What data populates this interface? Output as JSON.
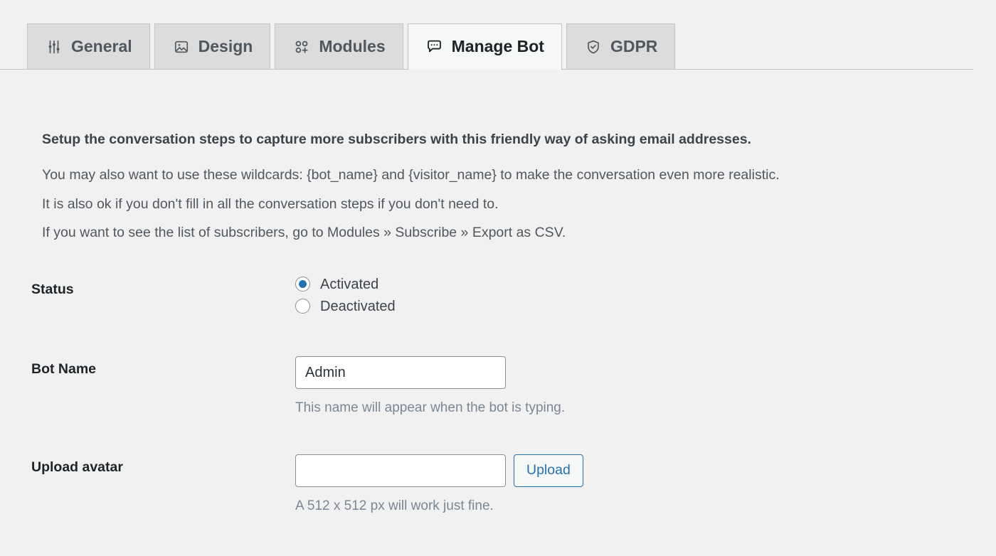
{
  "tabs": [
    {
      "id": "general",
      "label": "General",
      "icon": "sliders-icon",
      "active": false
    },
    {
      "id": "design",
      "label": "Design",
      "icon": "image-icon",
      "active": false
    },
    {
      "id": "modules",
      "label": "Modules",
      "icon": "modules-grid-icon",
      "active": false
    },
    {
      "id": "manage-bot",
      "label": "Manage Bot",
      "icon": "speech-bubble-icon",
      "active": true
    },
    {
      "id": "gdpr",
      "label": "GDPR",
      "icon": "shield-check-icon",
      "active": false
    }
  ],
  "intro": {
    "title": "Setup the conversation steps to capture more subscribers with this friendly way of asking email addresses.",
    "line1": "You may also want to use these wildcards: {bot_name} and {visitor_name} to make the conversation even more realistic.",
    "line2": "It is also ok if you don't fill in all the conversation steps if you don't need to.",
    "line3": "If you want to see the list of subscribers, go to Modules » Subscribe » Export as CSV."
  },
  "form": {
    "status": {
      "label": "Status",
      "options": [
        {
          "value": "activated",
          "label": "Activated",
          "selected": true
        },
        {
          "value": "deactivated",
          "label": "Deactivated",
          "selected": false
        }
      ]
    },
    "bot_name": {
      "label": "Bot Name",
      "value": "Admin",
      "placeholder": "",
      "help": "This name will appear when the bot is typing."
    },
    "avatar": {
      "label": "Upload avatar",
      "value": "",
      "placeholder": "",
      "button_label": "Upload",
      "help": "A 512 x 512 px will work just fine."
    }
  },
  "colors": {
    "accent": "#2271b1",
    "page_bg": "#f1f1f1",
    "tab_inactive_bg": "#dcdcdc",
    "tab_active_bg": "#f6f7f7",
    "border": "#c3c4c7",
    "text_dark": "#1d2327",
    "text_muted": "#7b8794"
  }
}
